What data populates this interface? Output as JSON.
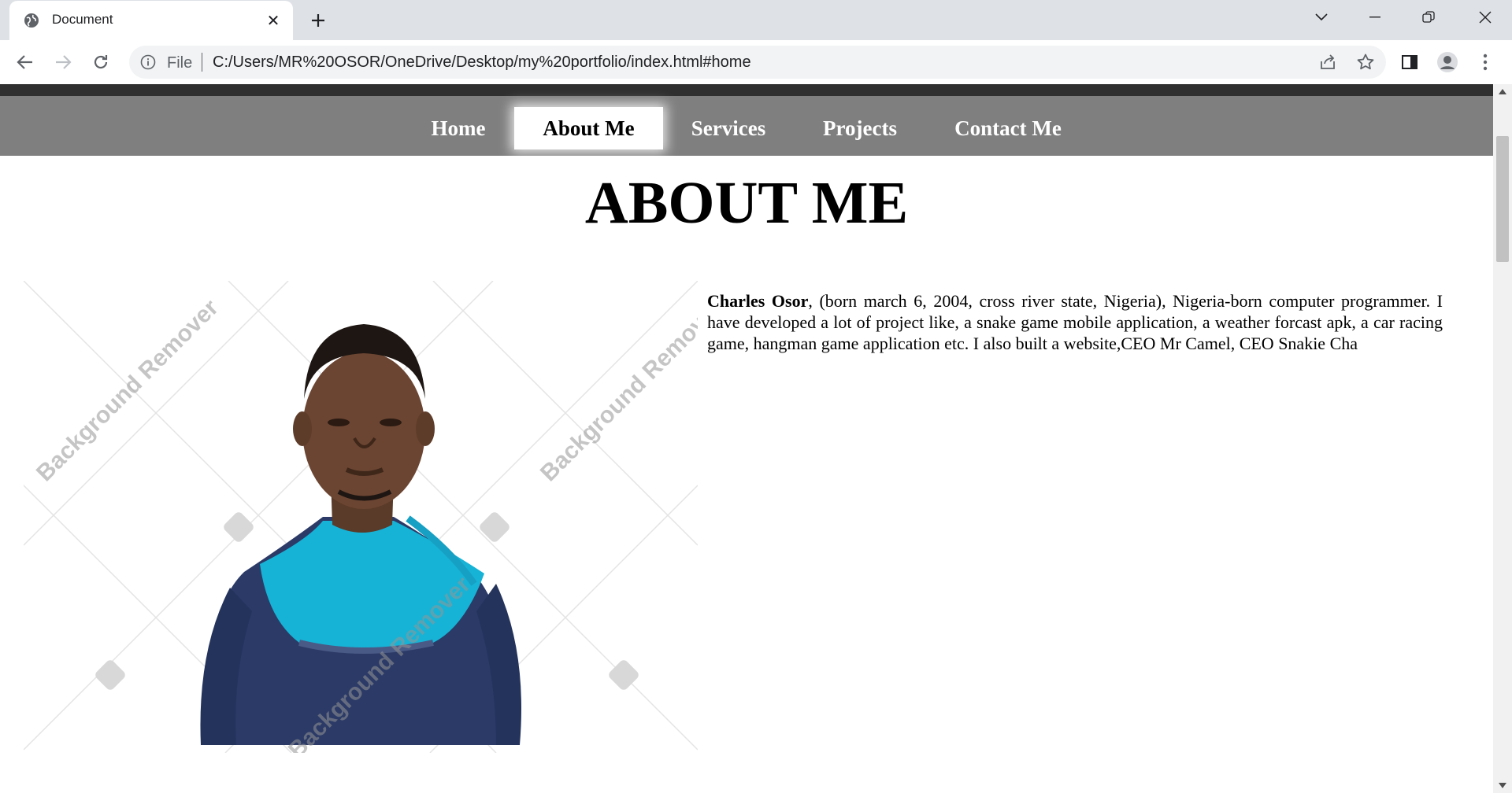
{
  "browser": {
    "tab_title": "Document",
    "omnibox_scheme": "File",
    "url": "C:/Users/MR%20OSOR/OneDrive/Desktop/my%20portfolio/index.html#home"
  },
  "nav": {
    "items": [
      {
        "label": "Home",
        "active": false
      },
      {
        "label": "About Me",
        "active": true
      },
      {
        "label": "Services",
        "active": false
      },
      {
        "label": "Projects",
        "active": false
      },
      {
        "label": "Contact Me",
        "active": false
      }
    ]
  },
  "about": {
    "title": "ABOUT ME",
    "name": "Charles Osor",
    "bio": ", (born march 6, 2004, cross river state, Nigeria), Nigeria-born computer programmer. I have developed a lot of project like, a snake game mobile application, a weather forcast apk, a car racing game, hangman game application etc. I also built a website,CEO Mr Camel, CEO Snakie Cha"
  },
  "photo": {
    "watermark": "Background Remover"
  },
  "colors": {
    "navbar_bg": "#7f7f7f",
    "navbar_top": "#2f2f2f",
    "shirt_dark": "#2b3a66",
    "shirt_accent": "#16b3d6"
  }
}
